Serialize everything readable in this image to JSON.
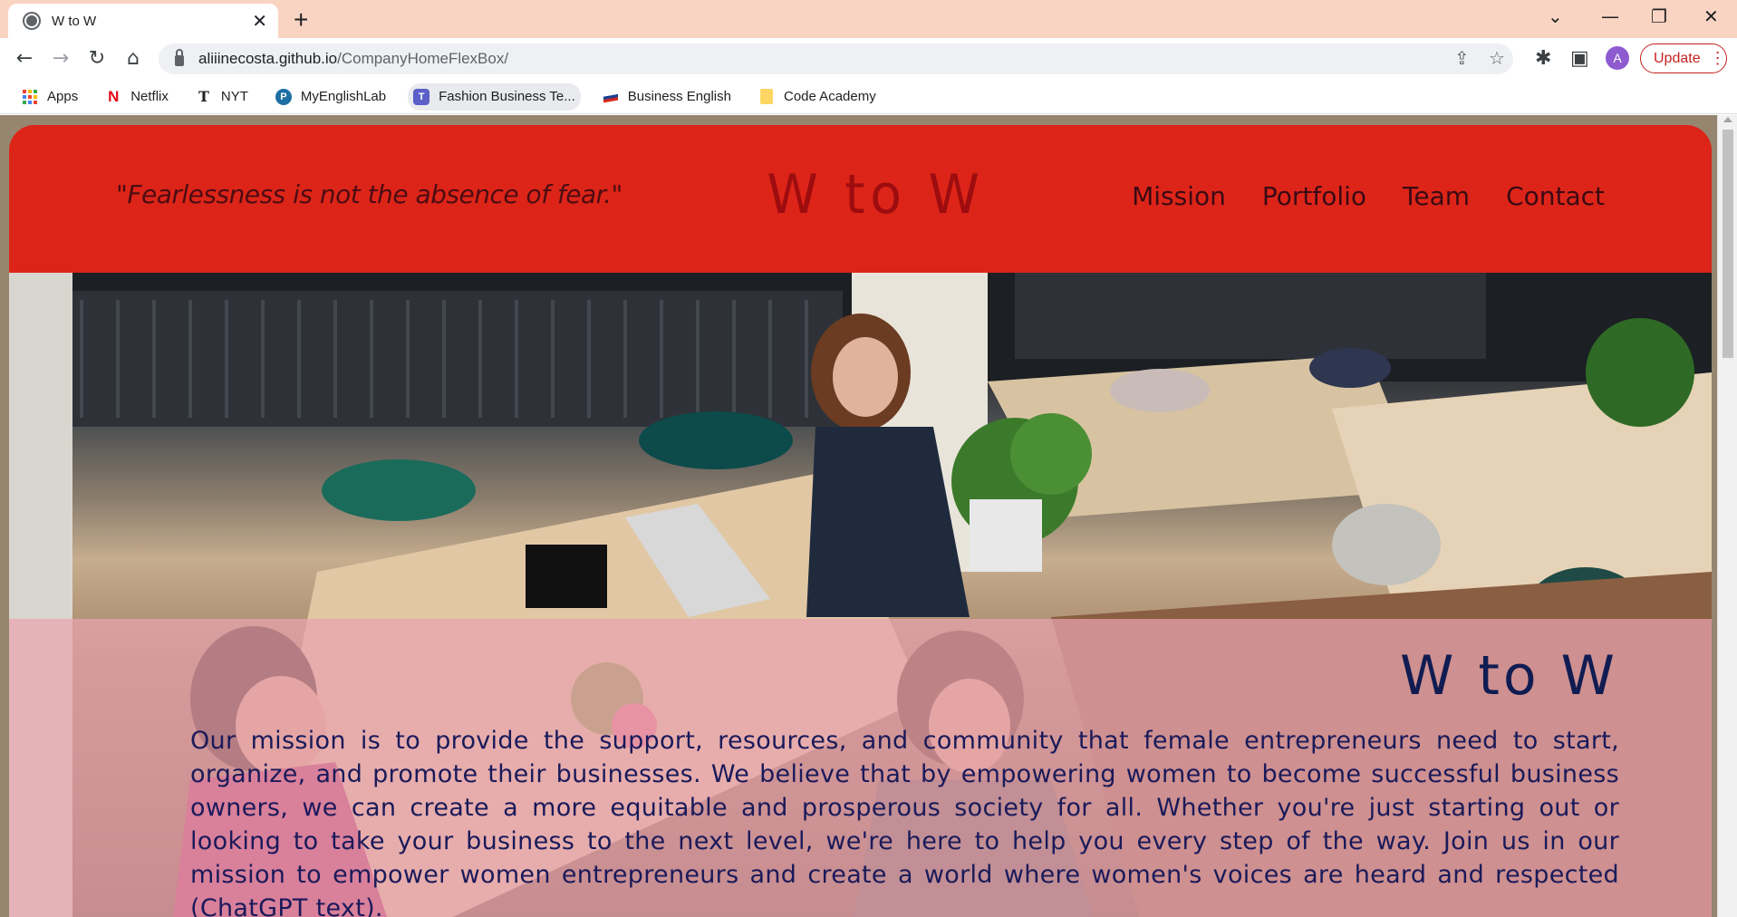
{
  "browser": {
    "tab_title": "W to W",
    "new_tab_symbol": "+",
    "url_host": "aliiinecosta.github.io",
    "url_path": "/CompanyHomeFlexBox/",
    "avatar_letter": "A",
    "update_label": "Update",
    "bookmarks": [
      {
        "label": "Apps",
        "icon": "apps-grid-icon"
      },
      {
        "label": "Netflix",
        "icon": "netflix-icon"
      },
      {
        "label": "NYT",
        "icon": "nyt-icon"
      },
      {
        "label": "MyEnglishLab",
        "icon": "myenglishlab-icon"
      },
      {
        "label": "Fashion Business Te...",
        "icon": "teams-icon"
      },
      {
        "label": "Business English",
        "icon": "flag-icon"
      },
      {
        "label": "Code Academy",
        "icon": "folder-icon"
      }
    ]
  },
  "site": {
    "quote": "\"Fearlessness is not the absence of fear.\"",
    "logo": "W to W",
    "nav": [
      "Mission",
      "Portfolio",
      "Team",
      "Contact"
    ],
    "mission_title": "W to W",
    "mission_text": "Our mission is to provide the support, resources, and community that female entrepreneurs need to start, organize, and promote their businesses. We believe that by empowering women to become successful business owners, we can create a more equitable and prosperous society for all. Whether you're just starting out or looking to take your business to the next level, we're here to help you every step of the way. Join us in our mission to empower women entrepreneurs and create a world where women's voices are heard and respected (ChatGPT text).",
    "colors": {
      "header_bg": "#dc2518",
      "logo": "#9d0c0f",
      "nav_text": "#3a0a14",
      "overlay": "#e9a3ae",
      "mission_title": "#101c52"
    }
  }
}
